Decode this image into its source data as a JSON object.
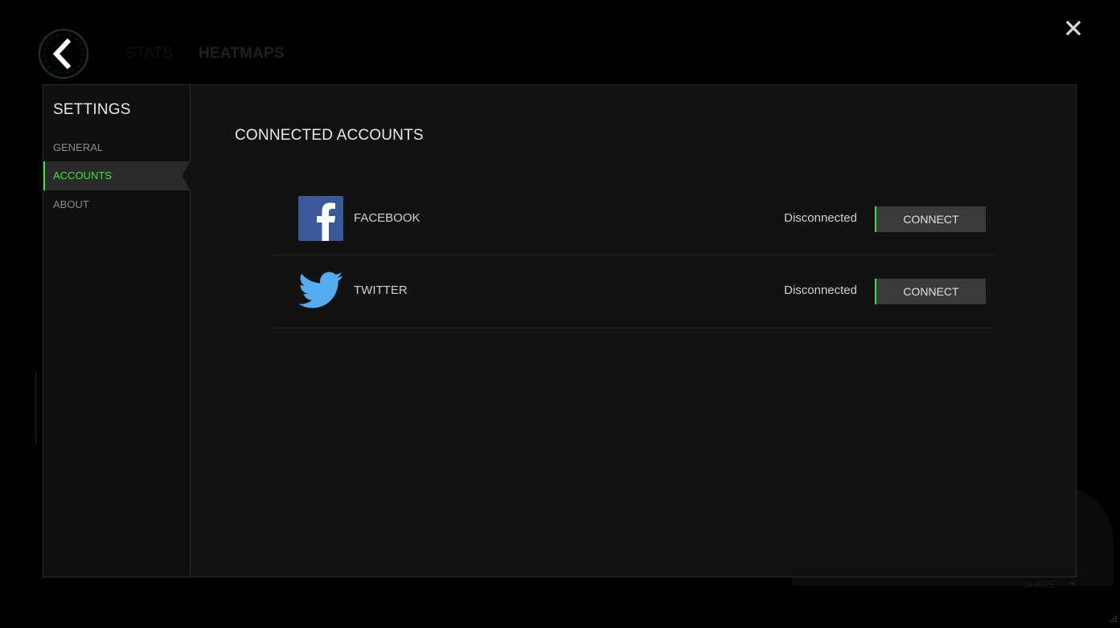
{
  "header": {
    "tabs": [
      {
        "label": "STATS"
      },
      {
        "label": "HEATMAPS"
      }
    ],
    "share_label": "SHARE"
  },
  "icons": {
    "back": "chevron-left-icon",
    "close": "close-icon",
    "facebook": "facebook-icon",
    "twitter": "twitter-icon"
  },
  "colors": {
    "accent": "#3ee33a",
    "facebook": "#3b5998",
    "twitter": "#55acee"
  },
  "settings": {
    "title": "SETTINGS",
    "nav": [
      {
        "label": "GENERAL"
      },
      {
        "label": "ACCOUNTS",
        "selected": true
      },
      {
        "label": "ABOUT"
      }
    ]
  },
  "accounts": {
    "title": "CONNECTED ACCOUNTS",
    "items": [
      {
        "name": "FACEBOOK",
        "status": "Disconnected",
        "action": "CONNECT"
      },
      {
        "name": "TWITTER",
        "status": "Disconnected",
        "action": "CONNECT"
      }
    ]
  }
}
